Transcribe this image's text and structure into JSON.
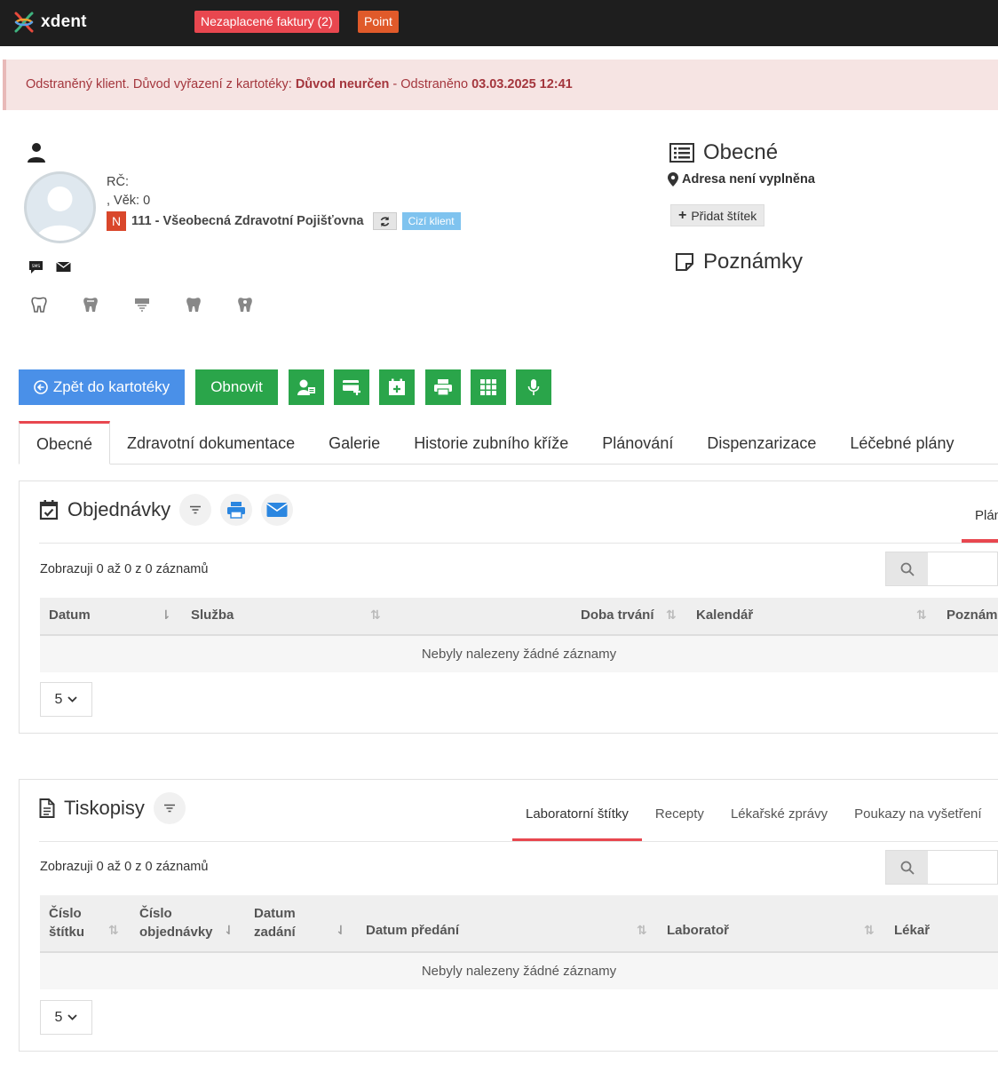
{
  "topbar": {
    "logo_text": "xdent",
    "badges": [
      {
        "label": "Nezaplacené faktury (2)",
        "color": "#e8474f"
      },
      {
        "label": "Point",
        "color": "#e05a2a"
      }
    ]
  },
  "alert": {
    "prefix": "Odstraněný klient. Důvod vyřazení z kartotéky: ",
    "reason": "Důvod neurčen",
    "middle": " - Odstraněno ",
    "datetime": "03.03.2025 12:41"
  },
  "client": {
    "rc_label": "RČ:",
    "age_line": ", Věk: 0",
    "insurance_badge": "N",
    "insurance_name": "111 - Všeobecná Zdravotní Pojišťovna",
    "foreign_badge": "Cizí klient",
    "contact_icons": [
      "sms-icon",
      "envelope-icon"
    ],
    "tooth_icons": [
      "tooth-icon",
      "tooth-icon",
      "tooth-icon",
      "tooth-icon",
      "tooth-icon"
    ]
  },
  "general": {
    "title": "Obecné",
    "address": "Adresa není vyplněna",
    "add_tag_label": "Přidat štítek",
    "notes_title": "Poznámky"
  },
  "actions": {
    "back_label": "Zpět do kartotéky",
    "refresh_label": "Obnovit",
    "icon_buttons": [
      "user-card-icon",
      "add-card-icon",
      "calendar-add-icon",
      "print-icon",
      "grid-icon",
      "microphone-icon"
    ]
  },
  "tabs": [
    {
      "label": "Obecné",
      "active": true
    },
    {
      "label": "Zdravotní dokumentace",
      "active": false
    },
    {
      "label": "Galerie",
      "active": false
    },
    {
      "label": "Historie zubního kříže",
      "active": false
    },
    {
      "label": "Plánování",
      "active": false
    },
    {
      "label": "Dispenzarizace",
      "active": false
    },
    {
      "label": "Léčebné plány",
      "active": false
    }
  ],
  "orders": {
    "title": "Objednávky",
    "right_tab_label": "Plán",
    "showing": "Zobrazuji 0 až 0 z 0 záznamů",
    "columns": [
      "Datum",
      "Služba",
      "Doba trvání",
      "Kalendář",
      "Poznám"
    ],
    "empty_text": "Nebyly nalezeny žádné záznamy",
    "page_size": "5"
  },
  "forms": {
    "title": "Tiskopisy",
    "subtabs": [
      {
        "label": "Laboratorní štítky",
        "active": true
      },
      {
        "label": "Recepty",
        "active": false
      },
      {
        "label": "Lékařské zprávy",
        "active": false
      },
      {
        "label": "Poukazy na vyšetření",
        "active": false
      }
    ],
    "showing": "Zobrazuji 0 až 0 z 0 záznamů",
    "columns": [
      {
        "line1": "Číslo",
        "line2": "štítku"
      },
      {
        "line1": "Číslo",
        "line2": "objednávky"
      },
      {
        "line1": "Datum",
        "line2": "zadání"
      },
      {
        "line1": "",
        "line2": "Datum předání"
      },
      {
        "line1": "",
        "line2": "Laboratoř"
      },
      {
        "line1": "",
        "line2": "Lékař"
      }
    ],
    "empty_text": "Nebyly nalezeny žádné záznamy",
    "page_size": "5"
  }
}
